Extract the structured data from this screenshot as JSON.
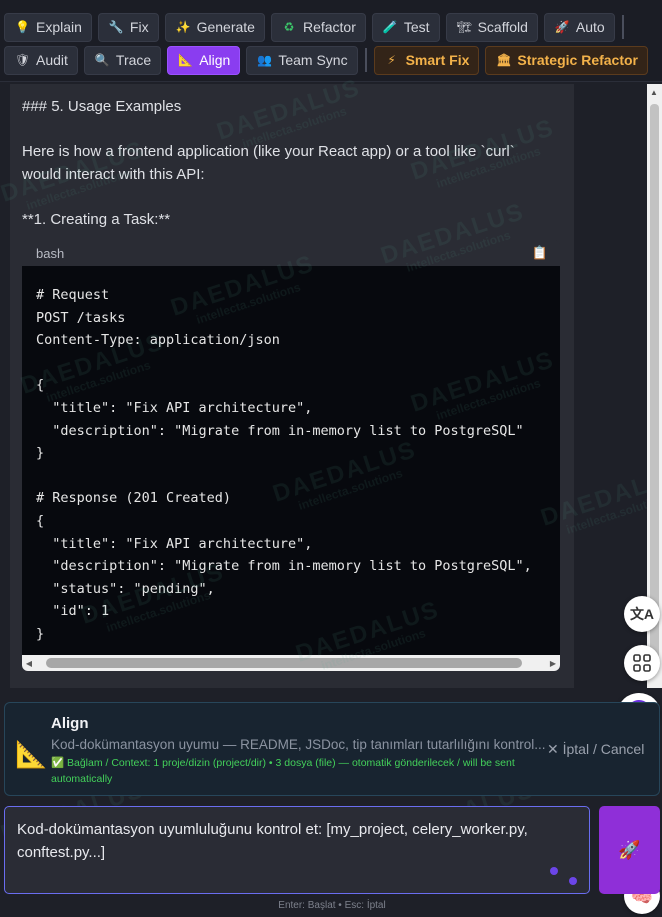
{
  "toolbar": {
    "row1": [
      {
        "icon": "💡",
        "label": "Explain"
      },
      {
        "icon": "🔧",
        "label": "Fix"
      },
      {
        "icon": "✨",
        "label": "Generate"
      },
      {
        "icon": "♻",
        "label": "Refactor"
      },
      {
        "icon": "🧪",
        "label": "Test"
      },
      {
        "icon": "🏗",
        "label": "Scaffold"
      },
      {
        "icon": "🚀",
        "label": "Auto"
      }
    ],
    "row2": [
      {
        "icon": "🛡",
        "label": "Audit"
      },
      {
        "icon": "🔍",
        "label": "Trace"
      },
      {
        "icon": "📐",
        "label": "Align"
      },
      {
        "icon": "👥",
        "label": "Team Sync"
      }
    ],
    "special": [
      {
        "icon": "⚡",
        "label": "Smart Fix"
      },
      {
        "icon": "🏛",
        "label": "Strategic Refactor"
      }
    ]
  },
  "content": {
    "heading": "### 5. Usage Examples",
    "intro_line1": "Here is how a frontend application (like your React app) or a tool like `curl`",
    "intro_line2": "would interact with this API:",
    "subheading": "**1. Creating a Task:**",
    "code_lang": "bash",
    "code": "# Request\nPOST /tasks\nContent-Type: application/json\n\n{\n  \"title\": \"Fix API architecture\",\n  \"description\": \"Migrate from in-memory list to PostgreSQL\"\n}\n\n# Response (201 Created)\n{\n  \"title\": \"Fix API architecture\",\n  \"description\": \"Migrate from in-memory list to PostgreSQL\",\n  \"status\": \"pending\",\n  \"id\": 1\n}"
  },
  "watermark": {
    "brand": "DAEDALUS",
    "sub": "intellecta.solutions"
  },
  "align_panel": {
    "title": "Align",
    "description": "Kod-dokümantasyon uyumu — README, JSDoc, tip tanımları tutarlılığını kontrol...",
    "context": "✅ Bağlam / Context: 1 proje/dizin (project/dir) • 3 dosya (file) — otomatik gönderilecek / will be sent automatically",
    "cancel": "✕ İptal / Cancel"
  },
  "input": {
    "value": "Kod-dokümantasyon uyumluluğunu kontrol et: [my_project, celery_worker.py, conftest.py...]"
  },
  "hint": "Enter: Başlat • Esc: İptal"
}
